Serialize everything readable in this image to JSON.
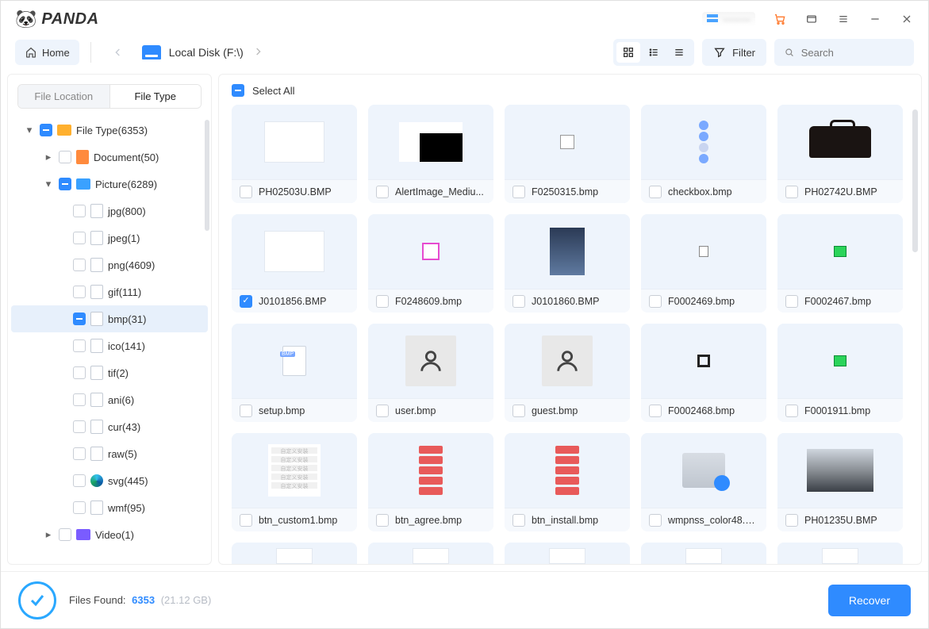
{
  "app": {
    "logo_text": "PANDA"
  },
  "user": {
    "name_masked": "········"
  },
  "toolbar": {
    "home_label": "Home",
    "breadcrumb_label": "Local Disk (F:\\)",
    "filter_label": "Filter",
    "search_placeholder": "Search"
  },
  "sidebar": {
    "tabs": {
      "location": "File Location",
      "type": "File Type"
    },
    "root": {
      "label": "File Type(6353)"
    },
    "document": {
      "label": "Document(50)"
    },
    "picture": {
      "label": "Picture(6289)"
    },
    "picture_children": {
      "jpg": "jpg(800)",
      "jpeg": "jpeg(1)",
      "png": "png(4609)",
      "gif": "gif(111)",
      "bmp": "bmp(31)",
      "ico": "ico(141)",
      "tif": "tif(2)",
      "ani": "ani(6)",
      "cur": "cur(43)",
      "raw": "raw(5)",
      "svg": "svg(445)",
      "wmf": "wmf(95)"
    },
    "video": {
      "label": "Video(1)"
    }
  },
  "content": {
    "select_all_label": "Select All",
    "items": [
      {
        "name": "PH02503U.BMP",
        "checked": false,
        "thumb": "building"
      },
      {
        "name": "AlertImage_Mediu...",
        "checked": false,
        "thumb": "black"
      },
      {
        "name": "F0250315.bmp",
        "checked": false,
        "thumb": "small"
      },
      {
        "name": "checkbox.bmp",
        "checked": false,
        "thumb": "checks"
      },
      {
        "name": "PH02742U.BMP",
        "checked": false,
        "thumb": "brief"
      },
      {
        "name": "J0101856.BMP",
        "checked": true,
        "thumb": "sky"
      },
      {
        "name": "F0248609.bmp",
        "checked": false,
        "thumb": "pink"
      },
      {
        "name": "J0101860.BMP",
        "checked": false,
        "thumb": "photo"
      },
      {
        "name": "F0002469.bmp",
        "checked": false,
        "thumb": "page"
      },
      {
        "name": "F0002467.bmp",
        "checked": false,
        "thumb": "green"
      },
      {
        "name": "setup.bmp",
        "checked": false,
        "thumb": "bmpfile"
      },
      {
        "name": "user.bmp",
        "checked": false,
        "thumb": "user"
      },
      {
        "name": "guest.bmp",
        "checked": false,
        "thumb": "user"
      },
      {
        "name": "F0002468.bmp",
        "checked": false,
        "thumb": "sq"
      },
      {
        "name": "F0001911.bmp",
        "checked": false,
        "thumb": "green"
      },
      {
        "name": "btn_custom1.bmp",
        "checked": false,
        "thumb": "cn"
      },
      {
        "name": "btn_agree.bmp",
        "checked": false,
        "thumb": "red"
      },
      {
        "name": "btn_install.bmp",
        "checked": false,
        "thumb": "red2"
      },
      {
        "name": "wmpnss_color48.b...",
        "checked": false,
        "thumb": "device"
      },
      {
        "name": "PH01235U.BMP",
        "checked": false,
        "thumb": "trees"
      }
    ]
  },
  "footer": {
    "label": "Files Found:",
    "count": "6353",
    "size": "(21.12 GB)",
    "recover_label": "Recover"
  }
}
